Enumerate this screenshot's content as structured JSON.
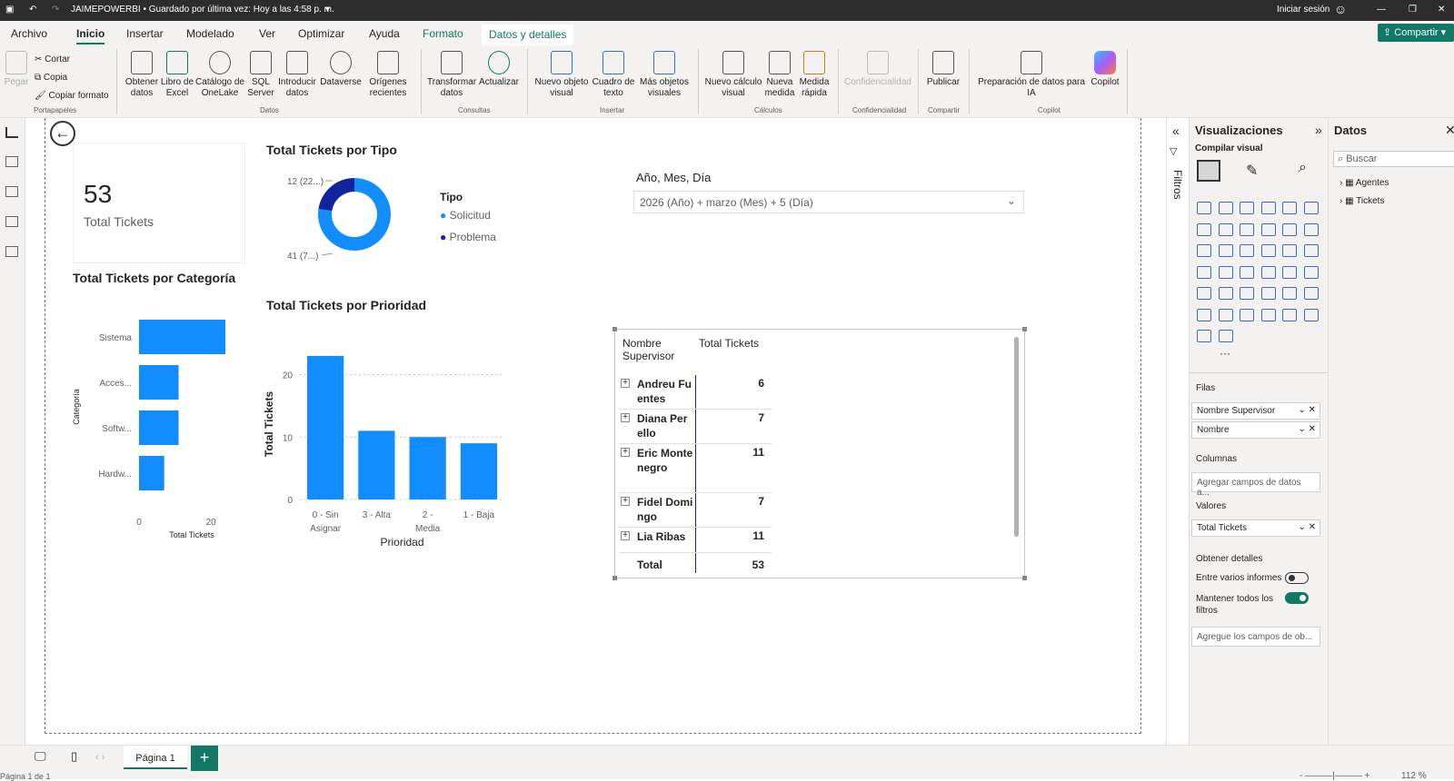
{
  "titlebar": {
    "title": "JAIMEPOWERBI • Guardado por última vez: Hoy a las 4:58 p. m.",
    "signin": "Iniciar sesión"
  },
  "menu": {
    "tabs": [
      "Archivo",
      "Inicio",
      "Insertar",
      "Modelado",
      "Ver",
      "Optimizar",
      "Ayuda",
      "Formato",
      "Datos y detalles"
    ],
    "share": "Compartir"
  },
  "ribbon": {
    "clip": {
      "paste": "Pegar",
      "cut": "Cortar",
      "copy": "Copia",
      "format": "Copiar formato",
      "group": "Portapapeles"
    },
    "datos": {
      "items": [
        "Obtener datos",
        "Libro de Excel",
        "Catálogo de OneLake",
        "SQL Server",
        "Introducir datos",
        "Dataverse",
        "Orígenes recientes"
      ],
      "group": "Datos"
    },
    "consultas": {
      "items": [
        "Transformar datos",
        "Actualizar"
      ],
      "group": "Consultas"
    },
    "insertar": {
      "items": [
        "Nuevo objeto visual",
        "Cuadro de texto",
        "Más objetos visuales"
      ],
      "group": "Insertar"
    },
    "calculos": {
      "items": [
        "Nuevo cálculo visual",
        "Nueva medida",
        "Medida rápida"
      ],
      "group": "Cálculos"
    },
    "conf": {
      "items": [
        "Confidencialidad"
      ],
      "group": "Confidencialidad"
    },
    "compartir": {
      "items": [
        "Publicar"
      ],
      "group": "Compartir"
    },
    "copilot": {
      "items": [
        "Preparación de datos para IA",
        "Copilot"
      ],
      "group": "Copilot"
    }
  },
  "card": {
    "value": "53",
    "label": "Total Tickets"
  },
  "donut": {
    "title": "Total Tickets por Tipo",
    "legend_title": "Tipo",
    "label_small": "12 (22...)",
    "label_big": "41 (7...)"
  },
  "slicer": {
    "title": "Año, Mes, Día",
    "value": "2026 (Año) + marzo (Mes) + 5 (Día)"
  },
  "matrix": {
    "headers": [
      "Nombre Supervisor",
      "Total Tickets"
    ],
    "rows": [
      {
        "name": "Andreu Fuentes",
        "value": "6"
      },
      {
        "name": "Diana Perello",
        "value": "7"
      },
      {
        "name": "Eric Montenegro",
        "value": "11"
      },
      {
        "name": "Fidel Domingo",
        "value": "7"
      },
      {
        "name": "Lia Ribas",
        "value": "11"
      }
    ],
    "total_label": "Total",
    "total_value": "53"
  },
  "chart_data": [
    {
      "type": "pie",
      "title": "Total Tickets por Tipo",
      "categories": [
        "Solicitud",
        "Problema"
      ],
      "values": [
        41,
        12
      ],
      "colors": [
        "#118DFF",
        "#12239E"
      ]
    },
    {
      "type": "bar",
      "orientation": "horizontal",
      "title": "Total Tickets por Categoría",
      "categories": [
        "Sistema",
        "Acces...",
        "Softw...",
        "Hardw..."
      ],
      "values": [
        24,
        11,
        11,
        7
      ],
      "xlabel": "Total Tickets",
      "ylabel": "Categoría",
      "xlim": [
        0,
        24
      ],
      "ticks": [
        0,
        20
      ]
    },
    {
      "type": "bar",
      "title": "Total Tickets por Prioridad",
      "categories": [
        "0 - Sin Asignar",
        "3 - Alta",
        "2 - Media",
        "1 - Baja"
      ],
      "values": [
        23,
        11,
        10,
        9
      ],
      "xlabel": "Prioridad",
      "ylabel": "Total Tickets",
      "ylim": [
        0,
        24
      ],
      "ticks": [
        0,
        10,
        20
      ]
    }
  ],
  "panels": {
    "filters": "Filtros",
    "viz_title": "Visualizaciones",
    "build": "Compilar visual",
    "data_title": "Datos",
    "search": "Buscar",
    "tables": [
      "Agentes",
      "Tickets"
    ],
    "filas": "Filas",
    "filas_fields": [
      "Nombre Supervisor",
      "Nombre"
    ],
    "columnas": "Columnas",
    "columnas_ph": "Agregar campos de datos a...",
    "valores": "Valores",
    "valores_fields": [
      "Total Tickets"
    ],
    "detalles": "Obtener detalles",
    "cross": "Entre varios informes",
    "keep": "Mantener todos los filtros",
    "drill_ph": "Agregue los campos de ob..."
  },
  "status": {
    "page_tab": "Página 1",
    "page_info": "Página 1 de 1",
    "zoom": "112 %"
  },
  "colors": {
    "accent": "#118DFF",
    "dark": "#12239E",
    "green": "#117865"
  }
}
